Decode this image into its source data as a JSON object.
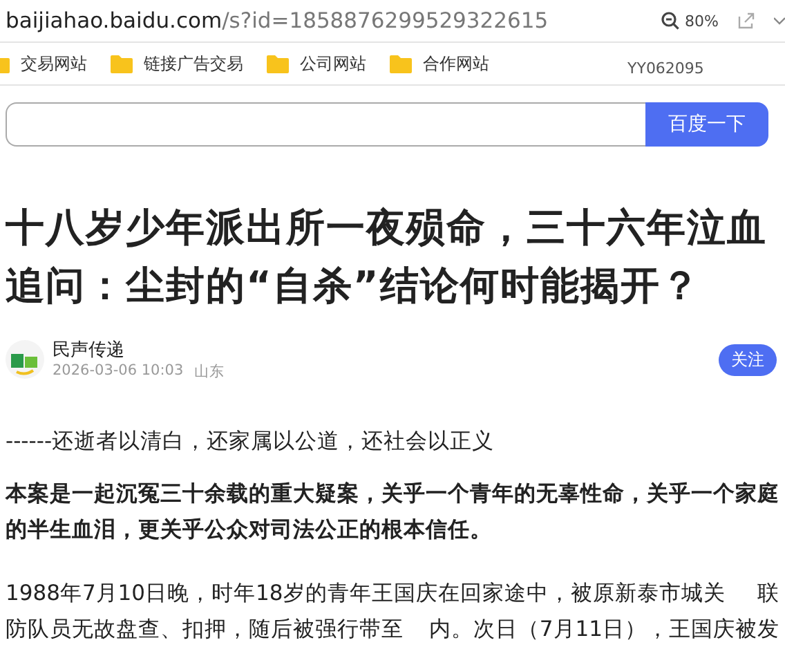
{
  "address_bar": {
    "domain": "baijiahao.baidu.com",
    "path": "/s?id=1858876299529322615",
    "zoom": "80%"
  },
  "bookmarks": [
    {
      "label": "交易网站"
    },
    {
      "label": "链接广告交易"
    },
    {
      "label": "公司网站"
    },
    {
      "label": "合作网站"
    }
  ],
  "bookmark_bar_note": "YY062095",
  "search": {
    "button": "百度一下"
  },
  "article": {
    "title": "十八岁少年派出所一夜殒命，三十六年泣血追问：尘封的“自杀”结论何时能揭开？",
    "author": "民声传递",
    "date": "2026-03-06 10:03",
    "location": "山东",
    "follow": "关注",
    "paragraphs": [
      {
        "kind": "plain",
        "text": "------还逝者以清白，还家属以公道，还社会以正义"
      },
      {
        "kind": "bold",
        "text": "本案是一起沉冤三十余载的重大疑案，关乎一个青年的无辜性命，关乎一个家庭的半生血泪，更关乎公众对司法公正的根本信任。"
      },
      {
        "kind": "obscured",
        "lines": [
          {
            "text": "1988年7月10日晚，时年18岁的青年王国庆在回家途中，被原新泰市城关",
            "tail": "联"
          },
          {
            "text": "防队员无故盘查、扣押，随后被强行带至",
            "tail": "内。次日（7月11日），王国庆被发"
          }
        ]
      }
    ]
  }
}
